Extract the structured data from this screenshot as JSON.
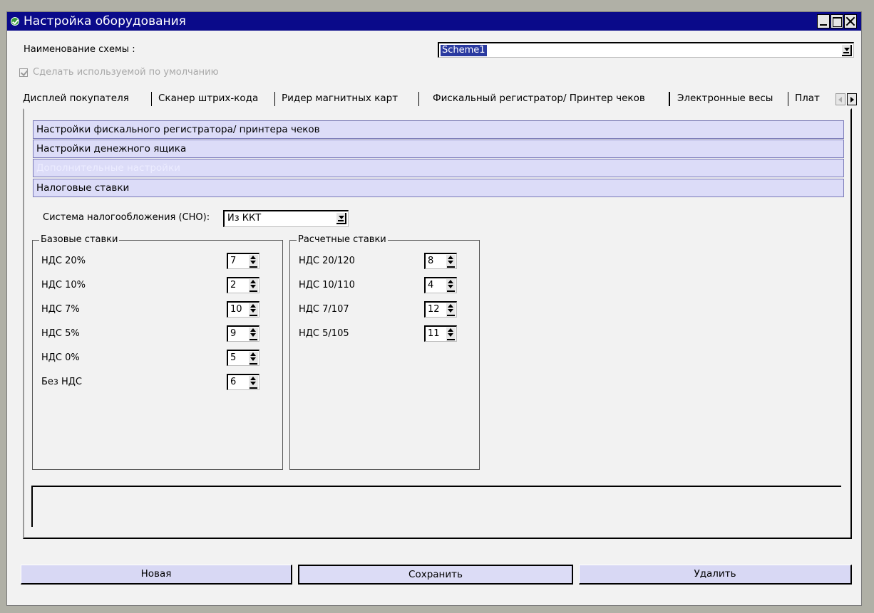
{
  "window": {
    "title": "Настройка оборудования"
  },
  "scheme": {
    "label": "Наименование схемы :",
    "value": "Scheme1",
    "default_checkbox_label": "Сделать используемой по умолчанию",
    "default_checked": true
  },
  "tabs": [
    {
      "label": "Дисплей покупателя",
      "active": false
    },
    {
      "label": "Сканер штрих-кода",
      "active": false
    },
    {
      "label": "Ридер магнитных карт",
      "active": false
    },
    {
      "label": "Фискальный регистратор/ Принтер чеков",
      "active": true
    },
    {
      "label": "Электронные весы",
      "active": false
    },
    {
      "label": "Плат",
      "active": false
    }
  ],
  "sections": [
    {
      "label": "Настройки фискального регистратора/ принтера чеков",
      "enabled": true
    },
    {
      "label": "Настройки денежного ящика",
      "enabled": true
    },
    {
      "label": "Дополнительные настройки",
      "enabled": false
    },
    {
      "label": "Налоговые ставки",
      "enabled": true
    }
  ],
  "tax_system": {
    "label": "Система налогообложения (СНО):",
    "value": "Из ККТ"
  },
  "base_rates": {
    "title": "Базовые ставки",
    "rows": [
      {
        "label": "НДС 20%",
        "value": "7"
      },
      {
        "label": "НДС 10%",
        "value": "2"
      },
      {
        "label": "НДС 7%",
        "value": "10"
      },
      {
        "label": "НДС 5%",
        "value": "9"
      },
      {
        "label": "НДС 0%",
        "value": "5"
      },
      {
        "label": "Без НДС",
        "value": "6"
      }
    ]
  },
  "calc_rates": {
    "title": "Расчетные ставки",
    "rows": [
      {
        "label": "НДС 20/120",
        "value": "8"
      },
      {
        "label": "НДС 10/110",
        "value": "4"
      },
      {
        "label": "НДС 7/107",
        "value": "12"
      },
      {
        "label": "НДС 5/105",
        "value": "11"
      }
    ]
  },
  "buttons": {
    "new": "Новая",
    "save": "Сохранить",
    "delete": "Удалить"
  }
}
